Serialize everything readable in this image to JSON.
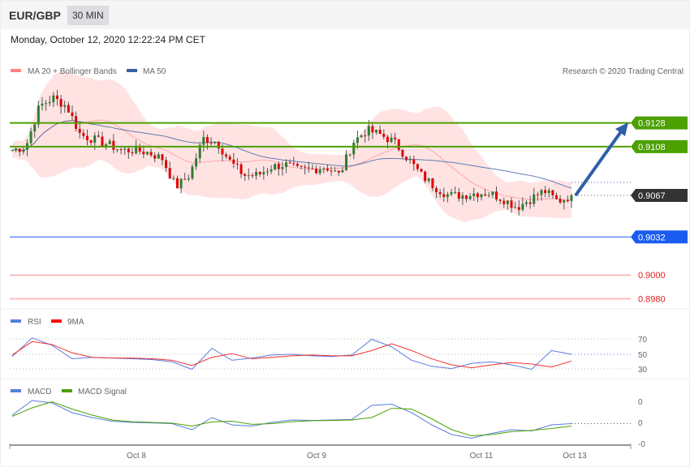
{
  "header": {
    "symbol": "EUR/GBP",
    "timeframe": "30 MIN"
  },
  "datetime": "Monday, October 12, 2020 12:22:24 PM CET",
  "legend": {
    "ma20": "MA 20 + Bollinger Bands",
    "ma50": "MA 50",
    "copyright": "Research © 2020 Trading Central"
  },
  "colors": {
    "ma20": "#ff8080",
    "ma50": "#3a5fa0",
    "resistance": "#4ca000",
    "current": "#333333",
    "support": "#1a5cf0",
    "level_red": "#e02020",
    "up": "#2e7d32",
    "down": "#e00000"
  },
  "levels": {
    "r2": "0.9128",
    "r1": "0.9108",
    "current": "0.9067",
    "s1": "0.9032",
    "l1": "0.9000",
    "l2": "0.8980"
  },
  "price_path": [
    0.9105,
    0.9108,
    0.9142,
    0.9149,
    0.9142,
    0.9118,
    0.9114,
    0.911,
    0.9105,
    0.9105,
    0.9103,
    0.9098,
    0.9074,
    0.9084,
    0.9115,
    0.9112,
    0.9095,
    0.9084,
    0.9084,
    0.9091,
    0.9093,
    0.9088,
    0.9089,
    0.9091,
    0.9084,
    0.9112,
    0.9122,
    0.9118,
    0.9112,
    0.9098,
    0.9084,
    0.9074,
    0.9067,
    0.9067,
    0.9069,
    0.9069,
    0.9064,
    0.9057,
    0.9064,
    0.9071,
    0.9062,
    0.9067
  ],
  "rsi": {
    "label": "RSI",
    "ma_label": "9MA",
    "ticks": [
      "70",
      "50",
      "30"
    ],
    "values": [
      47,
      72,
      62,
      44,
      46,
      45,
      44,
      43,
      40,
      30,
      58,
      42,
      45,
      49,
      50,
      48,
      47,
      49,
      70,
      60,
      42,
      34,
      31,
      38,
      40,
      36,
      30,
      55,
      50
    ],
    "ma": [
      49,
      67,
      63,
      52,
      46,
      45,
      45,
      44,
      42,
      35,
      46,
      51,
      44,
      46,
      48,
      49,
      48,
      48,
      55,
      64,
      55,
      44,
      36,
      32,
      36,
      39,
      37,
      33,
      41
    ]
  },
  "macd": {
    "label": "MACD",
    "signal_label": "MACD Signal",
    "ticks": [
      "0",
      "0",
      "-0"
    ],
    "values": [
      0.3,
      0.9,
      0.8,
      0.4,
      0.2,
      0.05,
      0.0,
      -0.02,
      -0.05,
      -0.3,
      0.2,
      -0.1,
      -0.15,
      0.0,
      0.1,
      0.08,
      0.1,
      0.12,
      0.7,
      0.75,
      0.4,
      -0.1,
      -0.5,
      -0.65,
      -0.45,
      -0.3,
      -0.35,
      -0.1,
      -0.05
    ],
    "signal": [
      0.25,
      0.6,
      0.85,
      0.55,
      0.3,
      0.1,
      0.03,
      0.0,
      -0.03,
      -0.15,
      0.02,
      0.05,
      -0.08,
      -0.05,
      0.03,
      0.07,
      0.08,
      0.1,
      0.2,
      0.58,
      0.55,
      0.15,
      -0.3,
      -0.55,
      -0.5,
      -0.38,
      -0.33,
      -0.25,
      -0.15
    ]
  },
  "xaxis": {
    "ticks": [
      "Oct 8",
      "Oct 9",
      "Oct 11",
      "Oct 13"
    ]
  }
}
